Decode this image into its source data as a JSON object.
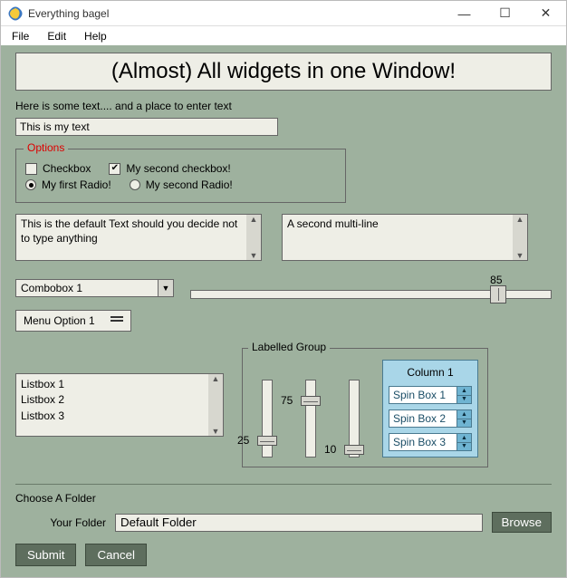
{
  "window": {
    "title": "Everything bagel",
    "controls": {
      "min": "—",
      "max": "☐",
      "close": "✕"
    }
  },
  "menu": {
    "file": "File",
    "edit": "Edit",
    "help": "Help"
  },
  "banner": "(Almost) All widgets in one Window!",
  "intro": "Here is some text.... and a place to enter text",
  "single_input_value": "This is my text",
  "options": {
    "legend": "Options",
    "cb1": "Checkbox",
    "cb2": "My second checkbox!",
    "rb1": "My first Radio!",
    "rb2": "My second Radio!"
  },
  "multi1": "This is the default Text should you decide not to type anything",
  "multi2": "A second multi-line",
  "combo_value": "Combobox 1",
  "hslider_value": "85",
  "menu_option": "Menu Option 1",
  "listbox": [
    "Listbox 1",
    "Listbox 2",
    "Listbox 3"
  ],
  "labelled": {
    "legend": "Labelled Group",
    "v1": "25",
    "v2": "75",
    "v3": "10",
    "col_header": "Column 1",
    "spins": [
      "Spin Box 1",
      "Spin Box 2",
      "Spin Box 3"
    ]
  },
  "folder": {
    "section": "Choose A Folder",
    "label": "Your Folder",
    "value": "Default Folder",
    "browse": "Browse"
  },
  "buttons": {
    "submit": "Submit",
    "cancel": "Cancel"
  }
}
